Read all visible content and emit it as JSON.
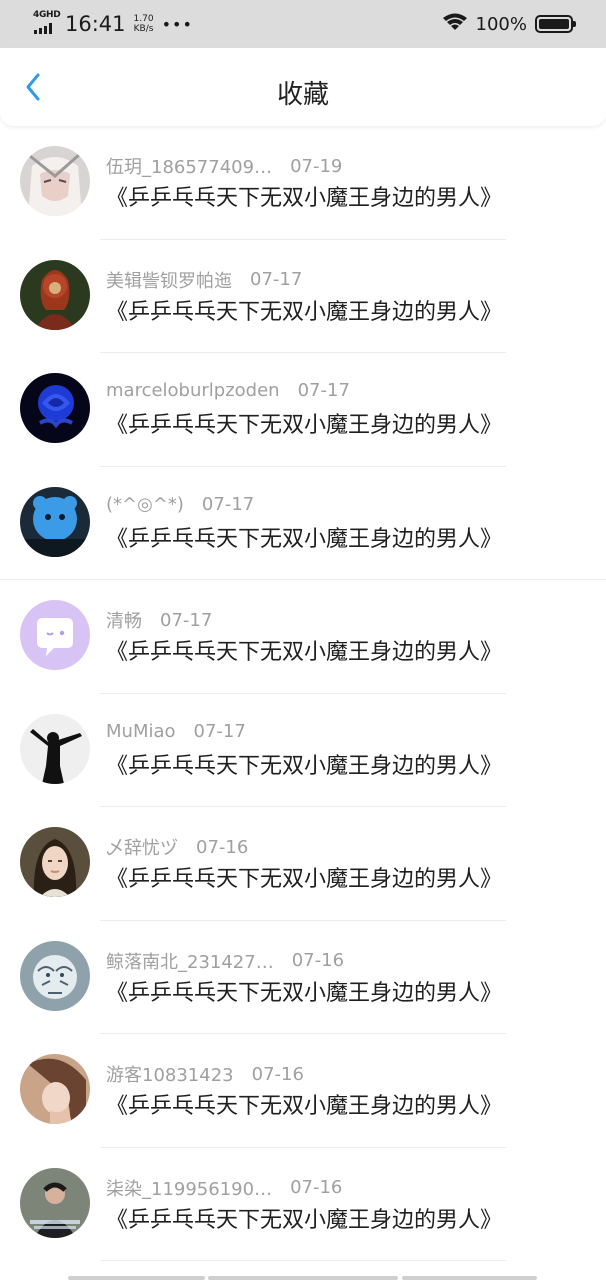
{
  "status_bar": {
    "network": "4GHD",
    "time": "16:41",
    "speed_value": "1.70",
    "speed_unit": "KB/s",
    "more": "•••",
    "battery_pct": "100%",
    "battery_level": 1.0
  },
  "nav": {
    "back_icon": "chevron-left-icon",
    "title": "收藏",
    "accent_color": "#2f9bea"
  },
  "items": [
    {
      "name": "伍玥_186577409…",
      "date": "07-19",
      "title": "《乒乒乓乓天下无双小魔王身边的男人》",
      "avatar": "anime-character-avatar"
    },
    {
      "name": "美辑訾钡罗帕迤",
      "date": "07-17",
      "title": "《乒乒乓乓天下无双小魔王身边的男人》",
      "avatar": "warrior-avatar"
    },
    {
      "name": "marceloburlpzoden",
      "date": "07-17",
      "title": "《乒乒乓乓天下无双小魔王身边的男人》",
      "avatar": "blue-rose-avatar"
    },
    {
      "name": "(*^◎^*)",
      "date": "07-17",
      "title": "《乒乒乓乓天下无双小魔王身边的男人》",
      "avatar": "blue-creature-avatar"
    },
    {
      "name": "清畅",
      "date": "07-17",
      "title": "《乒乒乓乓天下无双小魔王身边的男人》",
      "avatar": "chat-bubble-avatar"
    },
    {
      "name": "MuMiao",
      "date": "07-17",
      "title": "《乒乒乓乓天下无双小魔王身边的男人》",
      "avatar": "silhouette-avatar"
    },
    {
      "name": "乄辞忧ヅ",
      "date": "07-16",
      "title": "《乒乒乓乓天下无双小魔王身边的男人》",
      "avatar": "portrait-woman-avatar"
    },
    {
      "name": "鲸落南北_231427…",
      "date": "07-16",
      "title": "《乒乒乓乓天下无双小魔王身边的男人》",
      "avatar": "white-tiger-avatar"
    },
    {
      "name": "游客10831423",
      "date": "07-16",
      "title": "《乒乒乓乓天下无双小魔王身边的男人》",
      "avatar": "thinking-woman-avatar"
    },
    {
      "name": "柒染_119956190…",
      "date": "07-16",
      "title": "《乒乒乓乓天下无双小魔王身边的男人》",
      "avatar": "young-man-avatar"
    }
  ]
}
